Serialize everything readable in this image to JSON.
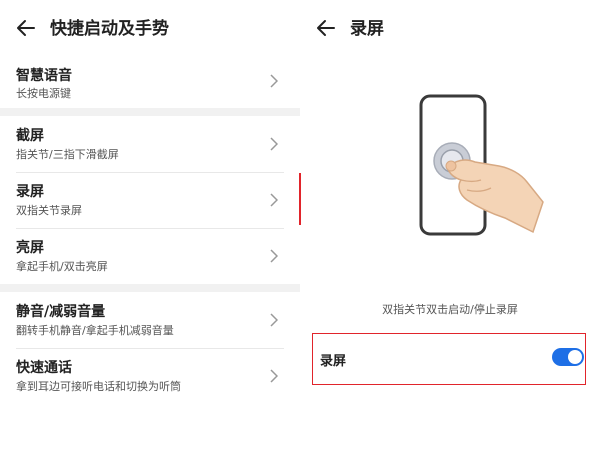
{
  "left_screen": {
    "title": "快捷启动及手势",
    "items": [
      {
        "title": "智慧语音",
        "subtitle": "长按电源键"
      },
      {
        "title": "截屏",
        "subtitle": "指关节/三指下滑截屏"
      },
      {
        "title": "录屏",
        "subtitle": "双指关节录屏"
      },
      {
        "title": "亮屏",
        "subtitle": "拿起手机/双击亮屏"
      },
      {
        "title": "静音/减弱音量",
        "subtitle": "翻转手机静音/拿起手机减弱音量"
      },
      {
        "title": "快速通话",
        "subtitle": "拿到耳边可接听电话和切换为听筒"
      }
    ]
  },
  "right_screen": {
    "title": "录屏",
    "caption": "双指关节双击启动/停止录屏",
    "toggle_row": {
      "label": "录屏",
      "enabled": true
    }
  },
  "colors": {
    "accent_blue": "#1e6fe6",
    "highlight_red": "#e1242b"
  }
}
